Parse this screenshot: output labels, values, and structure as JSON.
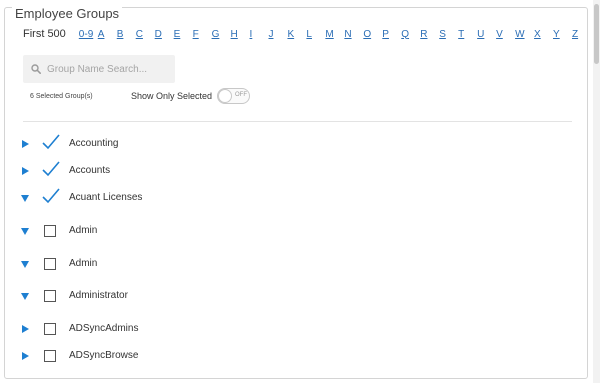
{
  "legend": "Employee Groups",
  "alpha": {
    "first": "First 500",
    "letters": [
      "0-9",
      "A",
      "B",
      "C",
      "D",
      "E",
      "F",
      "G",
      "H",
      "I",
      "J",
      "K",
      "L",
      "M",
      "N",
      "O",
      "P",
      "Q",
      "R",
      "S",
      "T",
      "U",
      "V",
      "W",
      "X",
      "Y",
      "Z"
    ]
  },
  "search": {
    "placeholder": "Group Name Search..."
  },
  "selected_count": "6 Selected Group(s)",
  "show_only": {
    "label": "Show Only Selected",
    "state": "OFF"
  },
  "colors": {
    "link": "#2a6db5",
    "expander": "#1e7fd1"
  },
  "groups": [
    {
      "name": "Accounting",
      "expander": "right",
      "checked": true
    },
    {
      "name": "Accounts",
      "expander": "right",
      "checked": true
    },
    {
      "name": "Acuant Licenses",
      "expander": "down",
      "checked": true
    },
    {
      "name": "Admin",
      "expander": "down",
      "checked": false
    },
    {
      "name": "Admin",
      "expander": "down",
      "checked": false
    },
    {
      "name": "Administrator",
      "expander": "down",
      "checked": false
    },
    {
      "name": "ADSyncAdmins",
      "expander": "right",
      "checked": false
    },
    {
      "name": "ADSyncBrowse",
      "expander": "right",
      "checked": false
    }
  ]
}
